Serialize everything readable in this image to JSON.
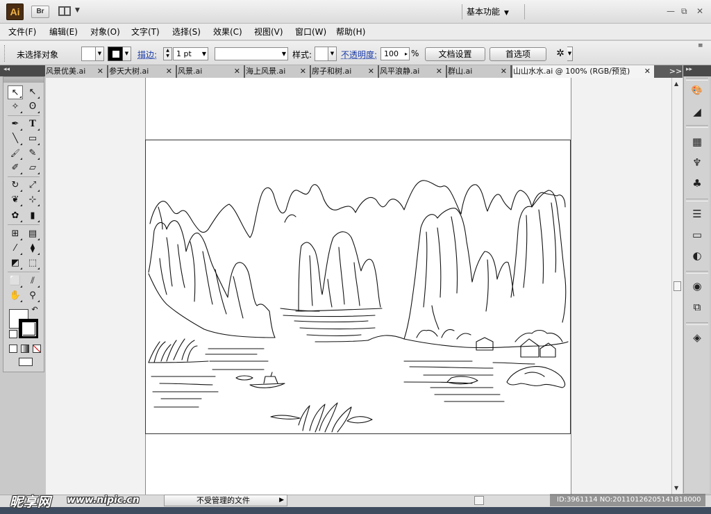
{
  "app": {
    "logo": "Ai",
    "bridge": "Br",
    "workspace": "基本功能",
    "colors": {
      "logo_bg": "#4a2d12",
      "logo_fg": "#f2b54a",
      "link": "#1a3aa8"
    }
  },
  "window_controls": {
    "minimize": "—",
    "restore": "⧉",
    "close": "✕"
  },
  "menu": [
    "文件(F)",
    "编辑(E)",
    "对象(O)",
    "文字(T)",
    "选择(S)",
    "效果(C)",
    "视图(V)",
    "窗口(W)",
    "帮助(H)"
  ],
  "control_bar": {
    "selection_status": "未选择对象",
    "stroke_label": "描边:",
    "stroke_weight": "1 pt",
    "style_label": "样式:",
    "opacity_label": "不透明度:",
    "opacity_value": "100",
    "opacity_unit": "%",
    "document_setup": "文档设置",
    "preferences": "首选项"
  },
  "tabs": [
    {
      "label": "风景优美.ai"
    },
    {
      "label": "参天大树.ai"
    },
    {
      "label": "风景.ai"
    },
    {
      "label": "海上风景.ai"
    },
    {
      "label": "房子和树.ai"
    },
    {
      "label": "风平浪静.ai"
    },
    {
      "label": "群山.ai"
    },
    {
      "label": "山山水水.ai @ 100% (RGB/预览)",
      "active": true
    }
  ],
  "tabs_overflow": ">>",
  "panel_collapse_left": "◂◂",
  "panel_collapse_right": "▸▸",
  "tools": [
    "selection-tool",
    "direct-selection-tool",
    "magic-wand-tool",
    "lasso-tool",
    "pen-tool",
    "type-tool",
    "line-segment-tool",
    "rectangle-tool",
    "paintbrush-tool",
    "pencil-tool",
    "blob-brush-tool",
    "eraser-tool",
    "rotate-tool",
    "scale-tool",
    "warp-tool",
    "free-transform-tool",
    "symbol-sprayer-tool",
    "column-graph-tool",
    "mesh-tool",
    "gradient-tool",
    "eyedropper-tool",
    "blend-tool",
    "live-paint-bucket-tool",
    "live-paint-selection-tool",
    "artboard-tool",
    "slice-tool",
    "hand-tool",
    "zoom-tool"
  ],
  "tool_glyphs": {
    "selection": "↖",
    "direct": "↖",
    "wand": "✧",
    "lasso": "ʘ",
    "pen": "✒",
    "type": "T",
    "line": "╲",
    "rect": "▭",
    "brush": "🖌",
    "pencil": "✎",
    "blob": "✐",
    "eraser": "▱",
    "rotate": "↻",
    "scale": "⤢",
    "warp": "❦",
    "free": "⊹",
    "symbol": "✿",
    "graph": "▮",
    "mesh": "⊞",
    "gradient": "▤",
    "eyedrop": "⁄",
    "blend": "⧫",
    "paint": "◩",
    "paintsel": "⬚",
    "artboard": "⬜",
    "slice": "⫽",
    "hand": "✋",
    "zoom": "⚲",
    "swap": "↶"
  },
  "status_bar": {
    "file_status": "不受管理的文件"
  },
  "dock_icons": [
    "color-icon",
    "color-guide-icon",
    "swatches-icon",
    "brushes-icon",
    "symbols-icon",
    "stroke-icon",
    "gradient-icon",
    "transparency-icon",
    "appearance-icon",
    "graphic-styles-icon",
    "layers-icon"
  ],
  "dock_glyphs": [
    "🎨",
    "◢",
    "▦",
    "♆",
    "♣",
    "☰",
    "▭",
    "◐",
    "◉",
    "⧉",
    "◈"
  ],
  "watermark": {
    "logo": "昵享网",
    "url": "www.nipic.cn",
    "id_text": "ID:3961114 NO:20110126205141818000"
  }
}
